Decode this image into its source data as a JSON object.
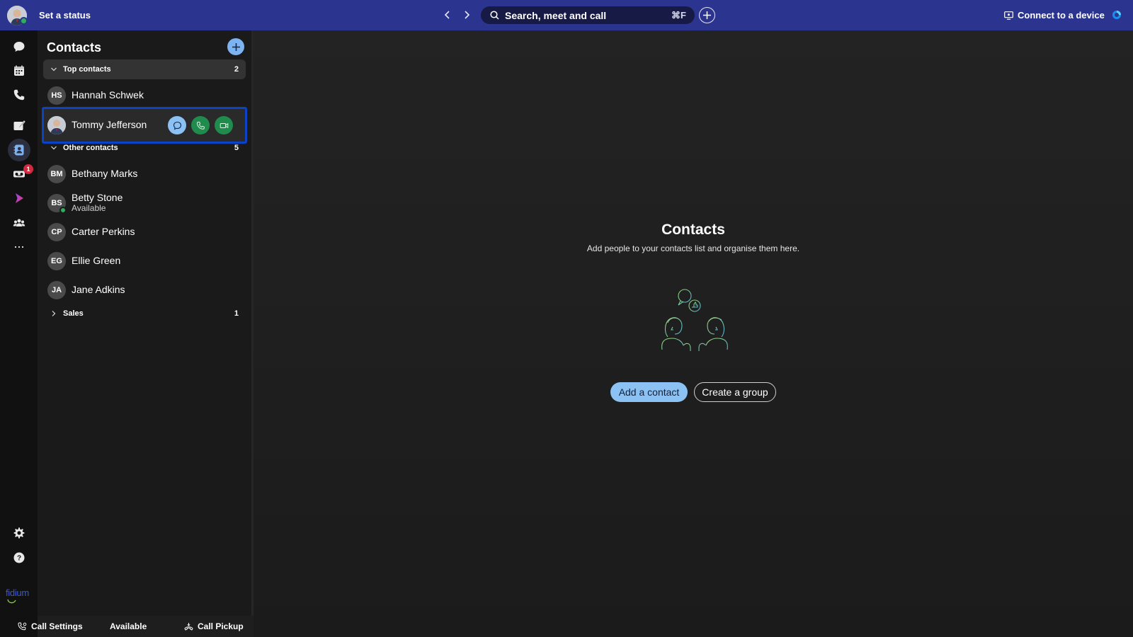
{
  "topbar": {
    "status_label": "Set a status",
    "search_placeholder": "Search, meet and call",
    "search_shortcut": "⌘F",
    "connect_label": "Connect to a device"
  },
  "rail": {
    "items": [
      "messaging-icon",
      "calendar-icon",
      "phone-icon",
      "whiteboard-icon",
      "contacts-icon",
      "voicemail-icon",
      "webex-apps-icon",
      "teams-icon",
      "more-icon"
    ],
    "voicemail_badge": "1",
    "active": "contacts-icon",
    "brand": "fidium"
  },
  "panel": {
    "title": "Contacts",
    "groups": [
      {
        "label": "Top contacts",
        "count": "2",
        "expanded": true
      },
      {
        "label": "Other contacts",
        "count": "5",
        "expanded": true
      },
      {
        "label": "Sales",
        "count": "1",
        "expanded": false
      }
    ],
    "top_contacts": [
      {
        "initials": "HS",
        "name": "Hannah Schwek"
      },
      {
        "initials": "",
        "name": "Tommy Jefferson",
        "selected": true
      }
    ],
    "other_contacts": [
      {
        "initials": "BM",
        "name": "Bethany Marks"
      },
      {
        "initials": "BS",
        "name": "Betty Stone",
        "status": "Available"
      },
      {
        "initials": "CP",
        "name": "Carter Perkins"
      },
      {
        "initials": "EG",
        "name": "Ellie Green"
      },
      {
        "initials": "JA",
        "name": "Jane Adkins"
      }
    ]
  },
  "main": {
    "title": "Contacts",
    "subtitle": "Add people to your contacts list and organise them here.",
    "add_contact_label": "Add a contact",
    "create_group_label": "Create a group"
  },
  "bottombar": {
    "call_settings": "Call Settings",
    "status": "Available",
    "call_pickup": "Call Pickup"
  },
  "colors": {
    "topbar": "#2b3590",
    "accent": "#8cc1f4",
    "selection_border": "#0a43c7",
    "presence": "#2fae5c",
    "badge": "#d1293d"
  }
}
